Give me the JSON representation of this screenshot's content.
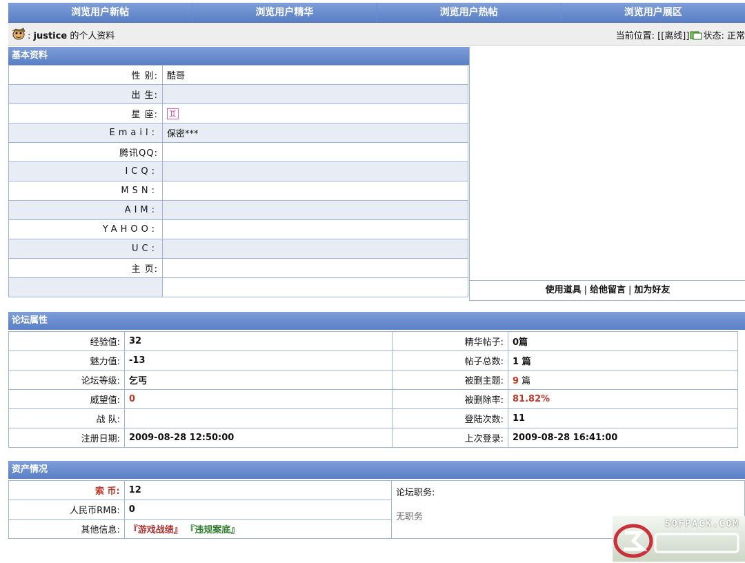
{
  "nav": {
    "items": [
      "浏览用户新帖",
      "浏览用户精华",
      "浏览用户热帖",
      "浏览用户展区"
    ]
  },
  "profile": {
    "username": "justice",
    "title_suffix": "的个人资料",
    "location_label": "当前位置:",
    "location_value": "[[离线]]",
    "status_label": "状态:",
    "status_value": "正常"
  },
  "basic": {
    "title": "基本资料",
    "rows": [
      {
        "label": "性 别:",
        "value": "酷哥"
      },
      {
        "label": "出 生:",
        "value": ""
      },
      {
        "label": "星 座:",
        "value": "♊"
      },
      {
        "label": "Email:",
        "value": "保密***"
      },
      {
        "label": "腾讯QQ:",
        "value": ""
      },
      {
        "label": "ICQ:",
        "value": ""
      },
      {
        "label": "MSN:",
        "value": ""
      },
      {
        "label": "AIM:",
        "value": ""
      },
      {
        "label": "YAHOO:",
        "value": ""
      },
      {
        "label": "UC:",
        "value": ""
      },
      {
        "label": "主 页:",
        "value": ""
      }
    ],
    "actions": {
      "use_item": "使用道具",
      "message": "给他留言",
      "add_friend": "加为好友",
      "sep": "|"
    }
  },
  "forum": {
    "title": "论坛属性",
    "rows": [
      {
        "l1": "经验值:",
        "v1": "32",
        "l2": "精华帖子:",
        "v2": "0篇"
      },
      {
        "l1": "魅力值:",
        "v1": "-13",
        "l2": "帖子总数:",
        "v2": "1 篇"
      },
      {
        "l1": "论坛等级:",
        "v1": "乞丐",
        "l2": "被删主题:",
        "v2_num": "9",
        "v2_unit": " 篇"
      },
      {
        "l1": "威望值:",
        "v1": "0",
        "l2": "被删除率:",
        "v2": "81.82%"
      },
      {
        "l1": "战 队:",
        "v1": "",
        "l2": "登陆次数:",
        "v2": "11"
      },
      {
        "l1": "注册日期:",
        "v1": "2009-08-28 12:50:00",
        "l2": "上次登录:",
        "v2": "2009-08-28 16:41:00"
      }
    ]
  },
  "assets": {
    "title": "资产情况",
    "coin_label": "索 币:",
    "coin_value": "12",
    "rmb_label": "人民币RMB:",
    "rmb_value": "0",
    "other_label": "其他信息:",
    "link_games": "『游戏战绩』",
    "link_violations": "『违规案底』",
    "duty_label": "论坛职务:",
    "duty_value": "无职务"
  },
  "watermark": {
    "text": "SOFPACK.COM"
  },
  "colors": {
    "header_blue": "#5a7fc6",
    "row_shade": "#e8edf5",
    "border": "#9db3d8",
    "accent_red": "#c0392b"
  }
}
